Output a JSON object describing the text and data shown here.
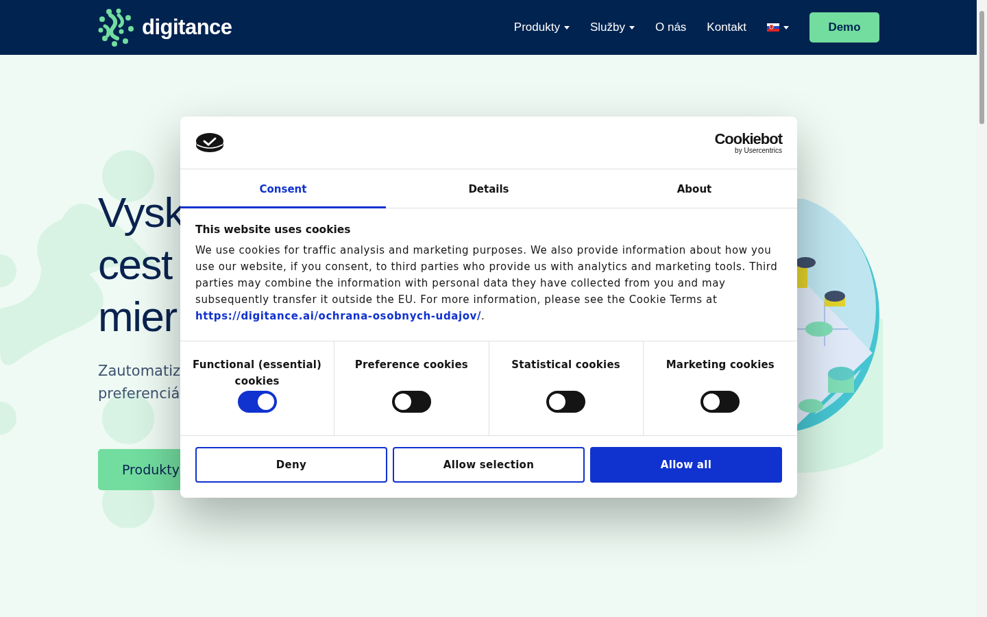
{
  "nav": {
    "brand": "digitance",
    "items": [
      {
        "label": "Produkty",
        "dropdown": true
      },
      {
        "label": "Služby",
        "dropdown": true
      },
      {
        "label": "O nás",
        "dropdown": false
      },
      {
        "label": "Kontakt",
        "dropdown": false
      }
    ],
    "language_dropdown": true,
    "cta": "Demo"
  },
  "hero": {
    "heading_lines": [
      "Vysk",
      "cest",
      "mier"
    ],
    "subtitle_lines": [
      "Zautomatiz",
      "preferenciá"
    ],
    "button": "Produkty",
    "illustration": {
      "kind": "picture"
    }
  },
  "cookie_dialog": {
    "brand": "Cookiebot",
    "brand_sub": "by Usercentrics",
    "tabs": [
      {
        "label": "Consent",
        "selected": true
      },
      {
        "label": "Details",
        "selected": false
      },
      {
        "label": "About",
        "selected": false
      }
    ],
    "title": "This website uses cookies",
    "text": "We use cookies for traffic analysis and marketing purposes. We also provide information about how you use our website, if you consent, to third parties who provide us with analytics and marketing tools. Third parties may combine the information with personal data they have collected from you and may subsequently transfer it outside the EU. For more information, please see the Cookie Terms at ",
    "link": "https://digitance.ai/ochrana-osobnych-udajov/",
    "link_suffix": ".",
    "categories": [
      {
        "label": "Functional (essential) cookies",
        "on": true
      },
      {
        "label": "Preference cookies",
        "on": false
      },
      {
        "label": "Statistical cookies",
        "on": false
      },
      {
        "label": "Marketing cookies",
        "on": false
      }
    ],
    "buttons": [
      {
        "label": "Deny",
        "kind": "outline"
      },
      {
        "label": "Allow selection",
        "kind": "outline"
      },
      {
        "label": "Allow all",
        "kind": "primary"
      }
    ]
  }
}
